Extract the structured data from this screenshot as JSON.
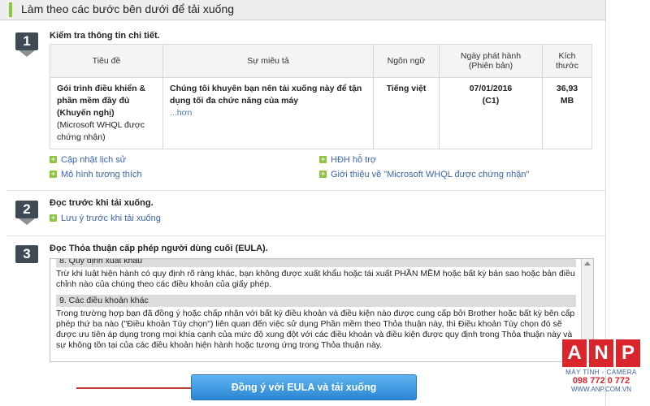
{
  "header": {
    "title": "Làm theo các bước bên dưới để tải xuống"
  },
  "step1": {
    "number": "1",
    "title": "Kiểm tra thông tin chi tiết.",
    "table": {
      "headers": [
        "Tiêu đề",
        "Sự miêu tả",
        "Ngôn ngữ",
        "Ngày phát hành\n(Phiên bản)",
        "Kích\nthước"
      ],
      "title_bold": "Gói trình điều khiển & phần mềm đầy đủ (Khuyến nghị)",
      "title_note": "(Microsoft WHQL được chứng nhận)",
      "description": "Chúng tôi khuyên bạn nên tải xuống này để tận dụng tối đa chức năng của máy",
      "more": "...hơn",
      "language": "Tiếng việt",
      "date": "07/01/2016",
      "version": "(C1)",
      "size": "36,93 MB"
    },
    "links": [
      "Cập nhật lịch sử",
      "HĐH hỗ trợ",
      "Mô hình tương thích",
      "Giới thiệu về \"Microsoft WHQL được chứng nhận\""
    ]
  },
  "step2": {
    "number": "2",
    "title": "Đọc trước khi tải xuống.",
    "link": "Lưu ý trước khi tải xuống"
  },
  "step3": {
    "number": "3",
    "title": "Đọc Thỏa thuận cấp phép người dùng cuối (EULA).",
    "eula": {
      "h8": "8. Quy định xuất khẩu",
      "p8": "Trừ khi luật hiện hành có quy định rõ ràng khác, bạn không được xuất khẩu hoặc tái xuất PHẦN MỀM hoặc bất kỳ bản sao hoặc bản điều chỉnh nào của chúng theo các điều khoản của giấy phép.",
      "h9": "9. Các điều khoản khác",
      "p9": "Trong trường hợp bạn đã đồng ý hoặc chấp nhận với bất kỳ điều khoản và điều kiện nào được cung cấp bởi Brother hoặc bất kỳ bên cấp phép thứ ba nào (\"Điều khoản Tùy chọn\") liên quan đến việc sử dụng Phần mềm theo Thỏa thuận này, thì Điều khoản Tùy chọn đó sẽ được ưu tiên áp dụng trong mọi khía cạnh của mức độ xung đột với các điều khoản và điều kiện được quy định trong Thỏa thuận này và sự không tồn tại của các điều khoản hiện hành hoặc tương ứng trong Thỏa thuận này."
    }
  },
  "button": {
    "label": "Đồng ý với EULA và tải xuống"
  },
  "watermark": {
    "letters": [
      "A",
      "N",
      "P"
    ],
    "line1": "MÁY TÍNH - CAMERA",
    "line2": "098 772 0 772",
    "line3": "WWW.ANP.COM.VN"
  },
  "colors": {
    "accent_green": "#8cc63f",
    "step_badge": "#3f4a55",
    "button_blue": "#2a86d4",
    "link_blue": "#3a66b0",
    "arrow_red": "#c0392b"
  }
}
